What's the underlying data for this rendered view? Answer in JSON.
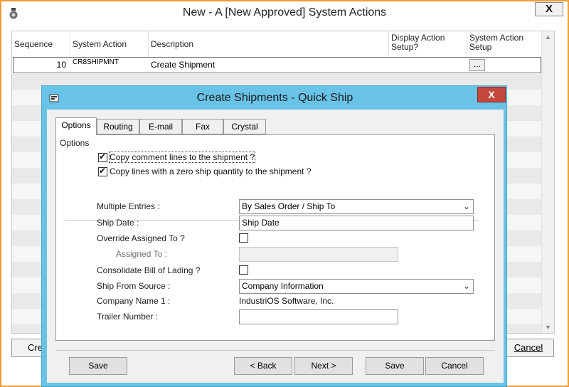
{
  "outer_window": {
    "title": "New - A [New Approved] System Actions",
    "close_glyph": "X",
    "app_icon": "app-icon"
  },
  "grid": {
    "headers": [
      "Sequence",
      "System Action",
      "Description",
      "Display Action Setup?",
      "System Action Setup"
    ],
    "row": {
      "sequence": "10",
      "system_action": "CR8SHIPMNT",
      "description": "Create Shipment",
      "setup_button": "..."
    }
  },
  "outer_buttons": {
    "create": "Cre",
    "cancel": "Cancel"
  },
  "dialog": {
    "title": "Create Shipments - Quick Ship",
    "close_glyph": "X",
    "tabs": [
      "Options",
      "Routing",
      "E-mail",
      "Fax",
      "Crystal"
    ],
    "group_label": "Options",
    "checkbox_copy_comments": {
      "label": "Copy comment lines to the shipment ?",
      "checked": true
    },
    "checkbox_copy_zero": {
      "label": "Copy lines with a zero ship quantity to the shipment ?",
      "checked": true
    },
    "fields": {
      "multiple_entries": {
        "label": "Multiple Entries :",
        "value": "By Sales Order / Ship To"
      },
      "ship_date": {
        "label": "Ship Date :",
        "value": "Ship Date"
      },
      "override_assigned": {
        "label": "Override Assigned To ?",
        "checked": false
      },
      "assigned_to": {
        "label": "Assigned To :",
        "value": ""
      },
      "consolidate_bol": {
        "label": "Consolidate Bill of Lading ?",
        "checked": false
      },
      "ship_from_source": {
        "label": "Ship From Source :",
        "value": "Company Information"
      },
      "company_name": {
        "label": "Company Name 1 :",
        "value": "IndustriOS Software, Inc."
      },
      "trailer_number": {
        "label": "Trailer Number :",
        "value": ""
      }
    },
    "buttons": {
      "save_left": "Save",
      "back": "< Back",
      "next": "Next >",
      "save": "Save",
      "cancel": "Cancel"
    }
  }
}
